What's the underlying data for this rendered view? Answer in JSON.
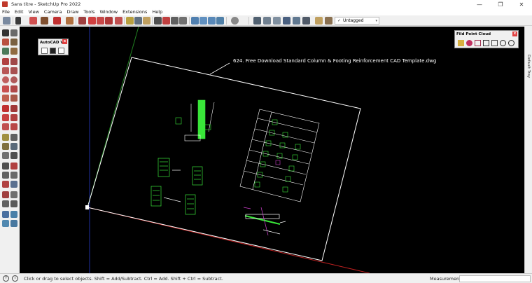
{
  "window": {
    "title": "Sans titre - SketchUp Pro 2022",
    "minimize": "—",
    "maximize": "❐",
    "close": "✕"
  },
  "menu": [
    "File",
    "Edit",
    "View",
    "Camera",
    "Draw",
    "Tools",
    "Window",
    "Extensions",
    "Help"
  ],
  "toolbar": {
    "tag_checkmark": "✓",
    "tag_value": "Untagged",
    "tag_caret": "▾"
  },
  "panels": {
    "autocad": {
      "title": "AutoCAD V...",
      "close": "x"
    },
    "point_cloud": {
      "title": "Fild Point Cloud",
      "close": "x"
    }
  },
  "tray": {
    "label": "Default Tray"
  },
  "viewport": {
    "drawing_label": "624. Free Download Standard Column & Footing Reinforcement CAD Template.dwg",
    "colors": {
      "background": "#000000",
      "outline": "#ffffff",
      "rebar": "#39e639",
      "annotation": "#d040d0",
      "red_axis": "#c02020",
      "green_axis": "#208020",
      "blue_axis": "#2030a0"
    }
  },
  "status": {
    "hint": "Click or drag to select objects. Shift = Add/Subtract. Ctrl = Add. Shift + Ctrl = Subtract.",
    "measurements_label": "Measurements",
    "measurements_value": ""
  }
}
